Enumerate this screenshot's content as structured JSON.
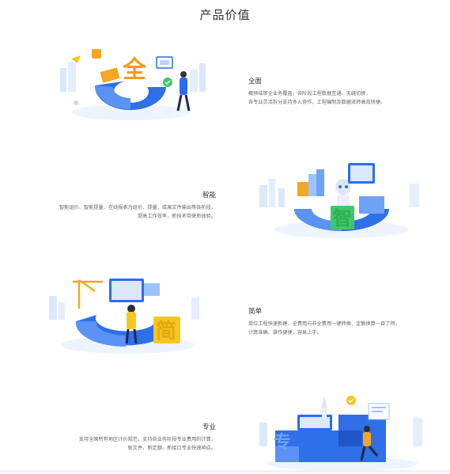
{
  "page": {
    "title": "产品价值"
  },
  "sections": [
    {
      "heading": "全面",
      "lines": [
        "概预结审全业务覆盖，各阶段工程数据互通、无缝切换，",
        "各专业灵活拆分支持多人协作，工程编制及数据流转高效快捷。"
      ],
      "badge_char": "全",
      "icon": "comprehensive-illustration"
    },
    {
      "heading": "智能",
      "lines": [
        "智能组价、智能提量、在线报表为组价、提量、成果文件输出等各阶段，",
        "提高工作效率，新技术带来新体验。"
      ],
      "badge_char": "智",
      "icon": "intelligent-illustration"
    },
    {
      "heading": "简单",
      "lines": [
        "单位工程快速新建、全费用与非全费用一键转换、定额换算一目了然，",
        "计算准确、操作便捷，容易上手。"
      ],
      "badge_char": "简",
      "icon": "simple-illustration"
    },
    {
      "heading": "专业",
      "lines": [
        "支持全国所有地区计价规范，支持各业务阶段专业费用的计算，",
        "新文件、新定额、新接口专业快速响应。"
      ],
      "badge_char": "专",
      "icon": "professional-illustration"
    }
  ],
  "colors": {
    "blue": "#2b6df0",
    "light_blue": "#9cc3fb",
    "orange": "#f6a623",
    "green": "#3fc86a",
    "yellow": "#f7c623"
  }
}
